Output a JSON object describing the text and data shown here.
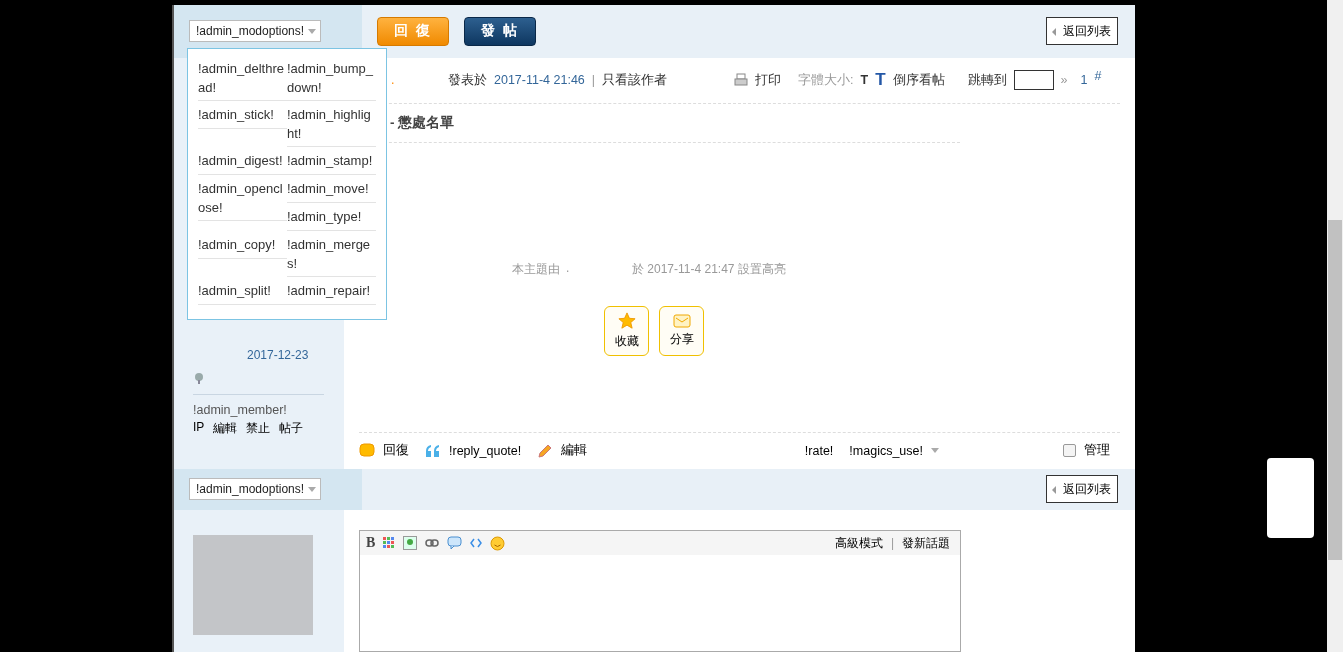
{
  "top_bar": {
    "mod_select": "!admin_modoptions!",
    "reply_button": "回 復",
    "post_button": "發 帖",
    "back_button": "返回列表"
  },
  "mod_menu": {
    "rows": [
      {
        "left": [
          "!admin_delthread!"
        ],
        "right": [
          "!admin_bump_down!"
        ]
      },
      {
        "left": [
          "!admin_stick!"
        ],
        "right": [
          "!admin_highlight!"
        ]
      },
      {
        "left": [
          "!admin_digest!"
        ],
        "right": [
          "!admin_stamp!"
        ]
      },
      {
        "left": [
          "!admin_openclose!"
        ],
        "right": [
          "!admin_move!",
          "!admin_type!"
        ]
      },
      {
        "left": [
          "!admin_copy!"
        ],
        "right": [
          "!admin_merges!"
        ]
      },
      {
        "left": [
          "!admin_split!"
        ],
        "right": [
          "!admin_repair!"
        ]
      }
    ]
  },
  "sidebar": {
    "date": "2017-12-23",
    "member_link": "!admin_member!",
    "actions": [
      "IP",
      "編輯",
      "禁止",
      "帖子"
    ]
  },
  "post_meta": {
    "author": ".",
    "posted_label": "發表於",
    "posted_time": "2017-11-4 21:46",
    "separator": "|",
    "author_only": "只看該作者",
    "print": "打印",
    "font_size_label": "字體大小:",
    "font_small": "T",
    "font_large": "T",
    "reverse": "倒序看帖",
    "jump_label": "跳轉到",
    "jump_arrow": "»",
    "floor": "1",
    "floor_mark": "#"
  },
  "post_title": "- 懲處名單",
  "notice": {
    "prefix": "本主題由",
    "user": ".",
    "suffix": "於 2017-11-4 21:47 設置高亮"
  },
  "post_buttons": [
    "收藏",
    "分享"
  ],
  "post_footer": {
    "reply": "回復",
    "quote": "!reply_quote!",
    "edit": "編輯",
    "rate": "!rate!",
    "magics": "!magics_use!",
    "manage": {
      "label": "管理",
      "checked": false
    }
  },
  "bottom_bar": {
    "mod_select": "!admin_modoptions!",
    "back_button": "返回列表"
  },
  "editor": {
    "bold": "B",
    "advanced": "高級模式",
    "separator": "|",
    "new_topic": "發新話題"
  }
}
